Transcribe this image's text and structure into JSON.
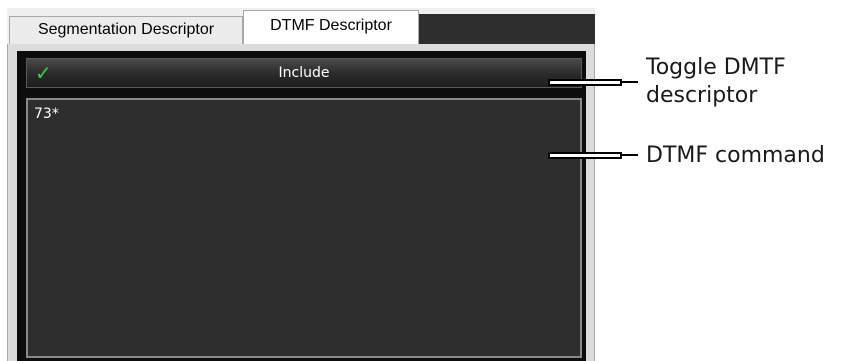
{
  "tabs": {
    "segmentation": "Segmentation Descriptor",
    "dtmf": "DTMF Descriptor"
  },
  "include_bar": {
    "label": "Include",
    "checked": true,
    "check_glyph": "✓"
  },
  "command": {
    "value": "73*"
  },
  "callouts": {
    "toggle_line1": "Toggle DMTF",
    "toggle_line2": "descriptor",
    "command": "DTMF command"
  }
}
